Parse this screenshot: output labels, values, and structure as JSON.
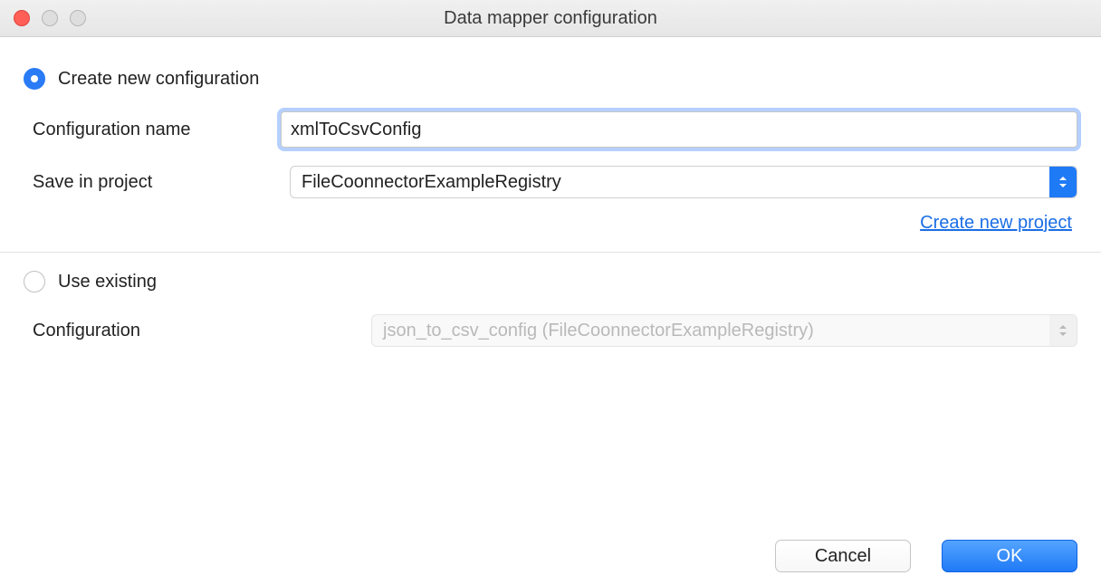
{
  "window": {
    "title": "Data mapper configuration"
  },
  "options": {
    "create_new_label": "Create new configuration",
    "use_existing_label": "Use existing",
    "selected": "create_new"
  },
  "create_new": {
    "config_name_label": "Configuration name",
    "config_name_value": "xmlToCsvConfig",
    "save_in_project_label": "Save in project",
    "save_in_project_value": "FileCoonnectorExampleRegistry",
    "create_new_project_link": "Create new project"
  },
  "use_existing": {
    "config_label": "Configuration",
    "config_value": "json_to_csv_config (FileCoonnectorExampleRegistry)"
  },
  "buttons": {
    "cancel": "Cancel",
    "ok": "OK"
  }
}
